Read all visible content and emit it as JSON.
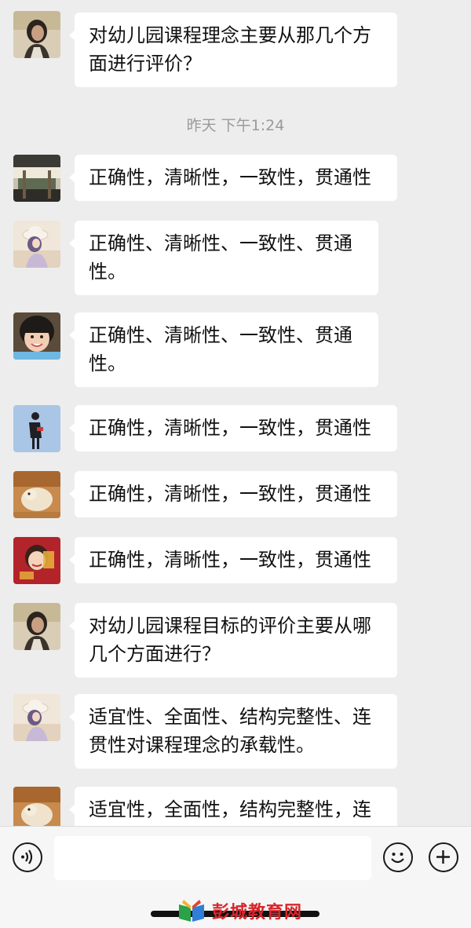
{
  "timestamp": "昨天 下午1:24",
  "messages": [
    {
      "avatar": "avatar-woman-portrait",
      "text": "对幼儿园课程理念主要从那几个方面进行评价？"
    },
    {
      "avatar": "avatar-room-scene",
      "text": "正确性，清晰性，一致性，贯通性"
    },
    {
      "avatar": "avatar-girl-hat",
      "text": "正确性、清晰性、一致性、贯通性。"
    },
    {
      "avatar": "avatar-child-face",
      "text": "正确性、清晰性、一致性、贯通性。"
    },
    {
      "avatar": "avatar-figure-blue",
      "text": "正确性，清晰性，一致性，贯通性"
    },
    {
      "avatar": "avatar-pet-photo",
      "text": "正确性，清晰性，一致性，贯通性"
    },
    {
      "avatar": "avatar-red-cartoon",
      "text": "正确性，清晰性，一致性，贯通性"
    },
    {
      "avatar": "avatar-woman-portrait",
      "text": "对幼儿园课程目标的评价主要从哪几个方面进行？"
    },
    {
      "avatar": "avatar-girl-hat",
      "text": "适宜性、全面性、结构完整性、连贯性对课程理念的承载性。"
    },
    {
      "avatar": "avatar-pet-photo",
      "text": "适宜性，全面性，结构完整性，连"
    }
  ],
  "input_bar": {
    "voice_icon": "voice-icon",
    "emoji_icon": "emoji-icon",
    "plus_icon": "plus-icon",
    "text_value": ""
  },
  "watermark": {
    "text": "彭城教育网"
  },
  "colors": {
    "background": "#ededed",
    "bubble": "#ffffff",
    "watermark_red": "#d8262c"
  }
}
